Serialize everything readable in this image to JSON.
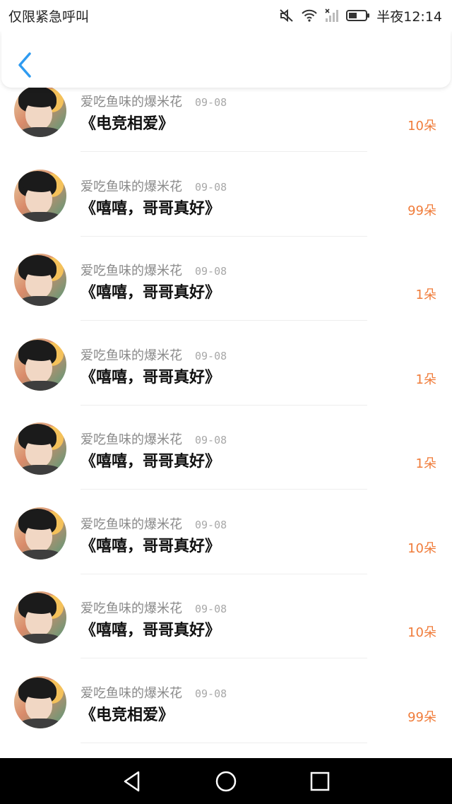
{
  "status_bar": {
    "carrier_text": "仅限紧急呼叫",
    "time": "半夜12:14",
    "icons": [
      "mute-icon",
      "wifi-icon",
      "no-signal-icon",
      "battery-icon"
    ]
  },
  "header": {
    "back_icon": "chevron-left-icon"
  },
  "colors": {
    "accent": "#2f9bf0",
    "amount": "#f07c3a"
  },
  "gifts": [
    {
      "sender": "爱吃鱼味的爆米花",
      "date": "09-08",
      "message": "《电竞相爱》",
      "amount": "10朵"
    },
    {
      "sender": "爱吃鱼味的爆米花",
      "date": "09-08",
      "message": "《嘻嘻，哥哥真好》",
      "amount": "99朵"
    },
    {
      "sender": "爱吃鱼味的爆米花",
      "date": "09-08",
      "message": "《嘻嘻，哥哥真好》",
      "amount": "1朵"
    },
    {
      "sender": "爱吃鱼味的爆米花",
      "date": "09-08",
      "message": "《嘻嘻，哥哥真好》",
      "amount": "1朵"
    },
    {
      "sender": "爱吃鱼味的爆米花",
      "date": "09-08",
      "message": "《嘻嘻，哥哥真好》",
      "amount": "1朵"
    },
    {
      "sender": "爱吃鱼味的爆米花",
      "date": "09-08",
      "message": "《嘻嘻，哥哥真好》",
      "amount": "10朵"
    },
    {
      "sender": "爱吃鱼味的爆米花",
      "date": "09-08",
      "message": "《嘻嘻，哥哥真好》",
      "amount": "10朵"
    },
    {
      "sender": "爱吃鱼味的爆米花",
      "date": "09-08",
      "message": "《电竞相爱》",
      "amount": "99朵"
    }
  ],
  "nav_bar": {
    "icons": [
      "back-triangle-icon",
      "home-circle-icon",
      "recents-square-icon"
    ]
  }
}
